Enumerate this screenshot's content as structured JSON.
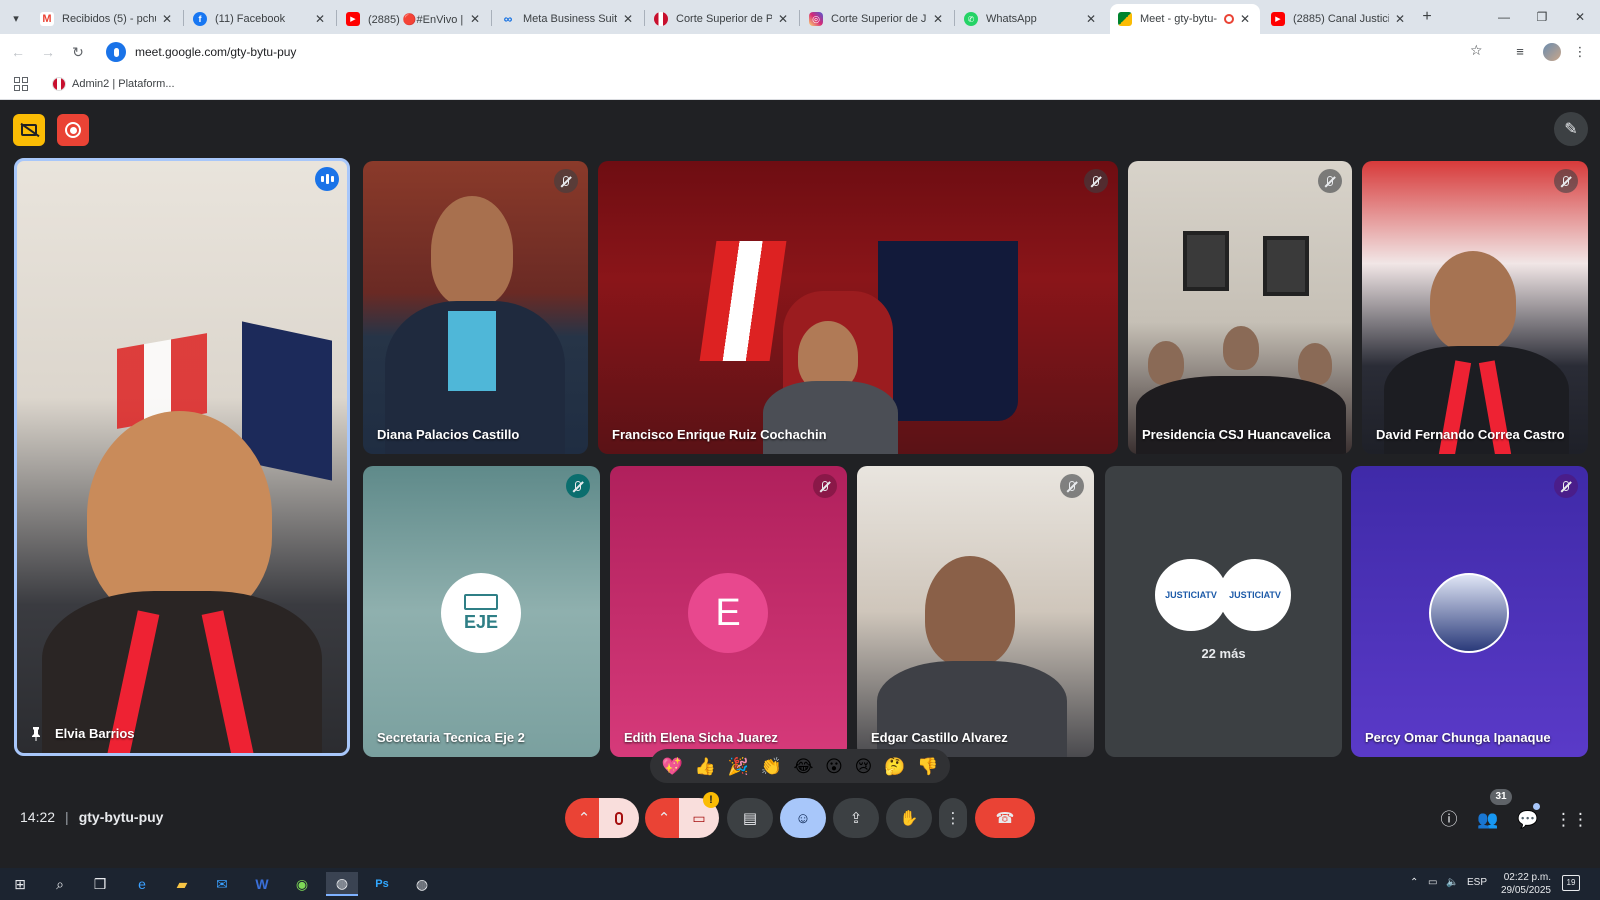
{
  "browser": {
    "tabs": [
      {
        "title": "Recibidos (5) - pchun",
        "icon": "gmail-icon",
        "color": "#ea4335",
        "active": false
      },
      {
        "title": "(11) Facebook",
        "icon": "facebook-icon",
        "color": "#1877f2",
        "active": false
      },
      {
        "title": "(2885) 🔴#EnVivo | A",
        "icon": "youtube-icon",
        "color": "#ff0000",
        "active": false
      },
      {
        "title": "Meta Business Suite",
        "icon": "meta-icon",
        "color": "#0668e1",
        "active": false
      },
      {
        "title": "Corte Superior de Piu",
        "icon": "poder-judicial-icon",
        "color": "#c8102e",
        "active": false
      },
      {
        "title": "Corte Superior de Ju",
        "icon": "instagram-icon",
        "color": "#d62976",
        "active": false
      },
      {
        "title": "WhatsApp",
        "icon": "whatsapp-icon",
        "color": "#25d366",
        "active": false
      },
      {
        "title": "Meet - gty-bytu-",
        "icon": "meet-icon",
        "color": "#00897b",
        "active": true
      },
      {
        "title": "(2885) Canal Justicia",
        "icon": "youtube-icon",
        "color": "#ff0000",
        "active": false
      }
    ],
    "url": "meet.google.com/gty-bytu-puy",
    "bookmarks": [
      {
        "label": "Admin2 | Plataform..."
      }
    ]
  },
  "meet": {
    "participants": [
      {
        "name": "Elvia Barrios",
        "pinned": true,
        "speaking": true
      },
      {
        "name": "Diana Palacios Castillo",
        "muted": true
      },
      {
        "name": "Francisco Enrique Ruiz Cochachin",
        "muted": true
      },
      {
        "name": "Presidencia CSJ Huancavelica",
        "muted": true
      },
      {
        "name": "David Fernando Correa Castro",
        "muted": true
      },
      {
        "name": "Secretaria Tecnica Eje 2",
        "muted": true,
        "logo_text": "EJE"
      },
      {
        "name": "Edith Elena Sicha Juarez",
        "muted": true,
        "initial": "E"
      },
      {
        "name": "Edgar Castillo Alvarez",
        "muted": true
      },
      {
        "name": "Percy Omar Chunga Ipanaque",
        "muted": true
      }
    ],
    "overflow": {
      "label": "22 más",
      "logo_text": "JUSTICIATV"
    },
    "reactions": [
      "💖",
      "👍",
      "🎉",
      "👏",
      "😂",
      "😮",
      "😢",
      "🤔",
      "👎"
    ],
    "time": "14:22",
    "meeting_code": "gty-bytu-puy",
    "people_count": "31",
    "colors": {
      "accent": "#a8c7fa",
      "end_call": "#ea4335",
      "background": "#202124"
    }
  },
  "taskbar": {
    "language": "ESP",
    "time": "02:22 p.m.",
    "date": "29/05/2025",
    "notifications": "19"
  }
}
